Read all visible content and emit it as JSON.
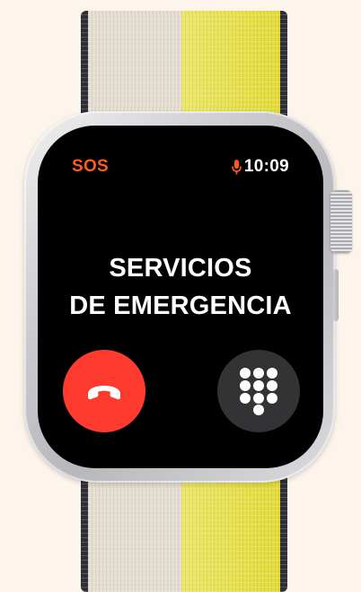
{
  "status_bar": {
    "sos_label": "SOS",
    "time": "10:09",
    "mic_icon": "microphone-icon"
  },
  "call": {
    "title_line_1": "SERVICIOS",
    "title_line_2": "DE EMERGENCIA"
  },
  "controls": {
    "end_call_icon": "phone-end-icon",
    "keypad_icon": "keypad-icon"
  },
  "colors": {
    "sos": "#ff5a1f",
    "end_call": "#ff3b30",
    "keypad_bg": "#333336",
    "screen_bg": "#000000",
    "page_bg": "#fdf5ec"
  }
}
